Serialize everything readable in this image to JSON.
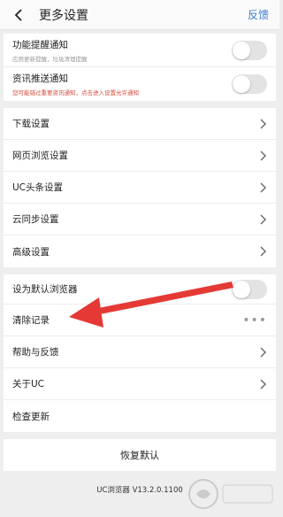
{
  "header": {
    "title": "更多设置",
    "feedback": "反馈"
  },
  "group1": [
    {
      "label": "功能提醒通知",
      "sub": "应用更新提醒，垃圾清理提醒",
      "toggle": "off"
    },
    {
      "label": "资讯推送通知",
      "sub": "您可能错过重要资讯通知，点击进入设置允许通知",
      "toggle": "off",
      "sub_color": "#d84a3b"
    }
  ],
  "group2": [
    {
      "label": "下载设置"
    },
    {
      "label": "网页浏览设置"
    },
    {
      "label": "UC头条设置"
    },
    {
      "label": "云同步设置"
    },
    {
      "label": "高级设置"
    }
  ],
  "group3": [
    {
      "label": "设为默认浏览器",
      "toggle": "off"
    },
    {
      "label": "清除记录",
      "icon": "more-dots"
    },
    {
      "label": "帮助与反馈"
    },
    {
      "label": "关于UC"
    },
    {
      "label": "检查更新"
    }
  ],
  "restore": "恢复默认",
  "version": "UC浏览器 V13.2.0.1100",
  "colors": {
    "link": "#3d7bd0",
    "warn": "#d84a3b",
    "annotation_arrow": "#e53935"
  }
}
